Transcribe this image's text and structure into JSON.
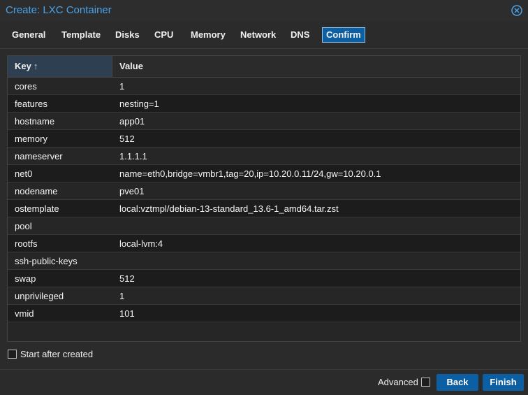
{
  "window": {
    "title": "Create: LXC Container"
  },
  "tabs": [
    {
      "label": "General"
    },
    {
      "label": "Template"
    },
    {
      "label": "Disks"
    },
    {
      "label": "CPU"
    },
    {
      "label": "Memory"
    },
    {
      "label": "Network"
    },
    {
      "label": "DNS"
    },
    {
      "label": "Confirm"
    }
  ],
  "active_tab": "Confirm",
  "grid": {
    "columns": {
      "key": "Key",
      "value": "Value"
    },
    "sort_indicator": "↑",
    "rows": [
      {
        "key": "cores",
        "value": "1"
      },
      {
        "key": "features",
        "value": "nesting=1"
      },
      {
        "key": "hostname",
        "value": "app01"
      },
      {
        "key": "memory",
        "value": "512"
      },
      {
        "key": "nameserver",
        "value": "1.1.1.1"
      },
      {
        "key": "net0",
        "value": "name=eth0,bridge=vmbr1,tag=20,ip=10.20.0.11/24,gw=10.20.0.1"
      },
      {
        "key": "nodename",
        "value": "pve01"
      },
      {
        "key": "ostemplate",
        "value": "local:vztmpl/debian-13-standard_13.6-1_amd64.tar.zst"
      },
      {
        "key": "pool",
        "value": ""
      },
      {
        "key": "rootfs",
        "value": "local-lvm:4"
      },
      {
        "key": "ssh-public-keys",
        "value": ""
      },
      {
        "key": "swap",
        "value": "512"
      },
      {
        "key": "unprivileged",
        "value": "1"
      },
      {
        "key": "vmid",
        "value": "101"
      }
    ]
  },
  "start_after_created": {
    "label": "Start after created",
    "checked": false
  },
  "footer": {
    "advanced_label": "Advanced",
    "advanced_checked": false,
    "back_label": "Back",
    "finish_label": "Finish"
  },
  "colors": {
    "accent": "#0d5fa3",
    "title": "#4aa3ea",
    "background": "#2b2b2b"
  },
  "icons": {
    "close": "close-circle-icon",
    "sort": "sort-ascending-icon"
  }
}
